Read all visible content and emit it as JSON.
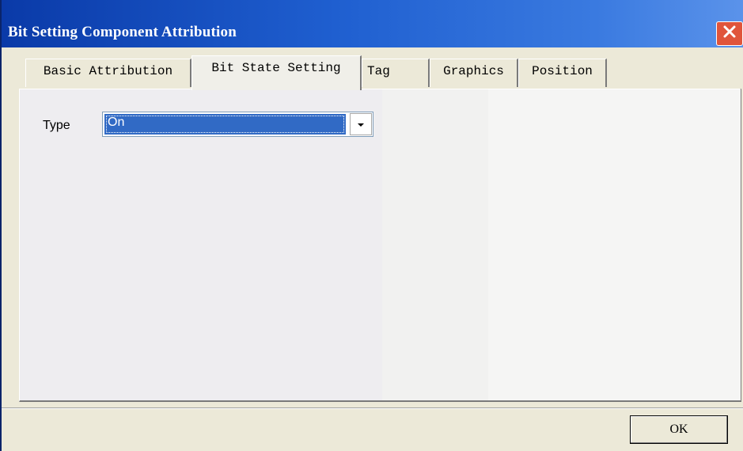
{
  "window": {
    "title": "Bit Setting Component Attribution",
    "close_icon": "close-icon"
  },
  "tabs": [
    {
      "label": "Basic Attribution",
      "active": false
    },
    {
      "label": "Bit State Setting",
      "active": true
    },
    {
      "label": "Tag",
      "active": false
    },
    {
      "label": "Graphics",
      "active": false
    },
    {
      "label": "Position",
      "active": false
    }
  ],
  "form": {
    "type_label": "Type",
    "type_value": "On",
    "dropdown_icon": "chevron-down-icon"
  },
  "buttons": {
    "ok_label": "OK"
  },
  "colors": {
    "titlebar": "#0a3aa8",
    "close": "#e0553b",
    "selection": "#316ac5"
  }
}
